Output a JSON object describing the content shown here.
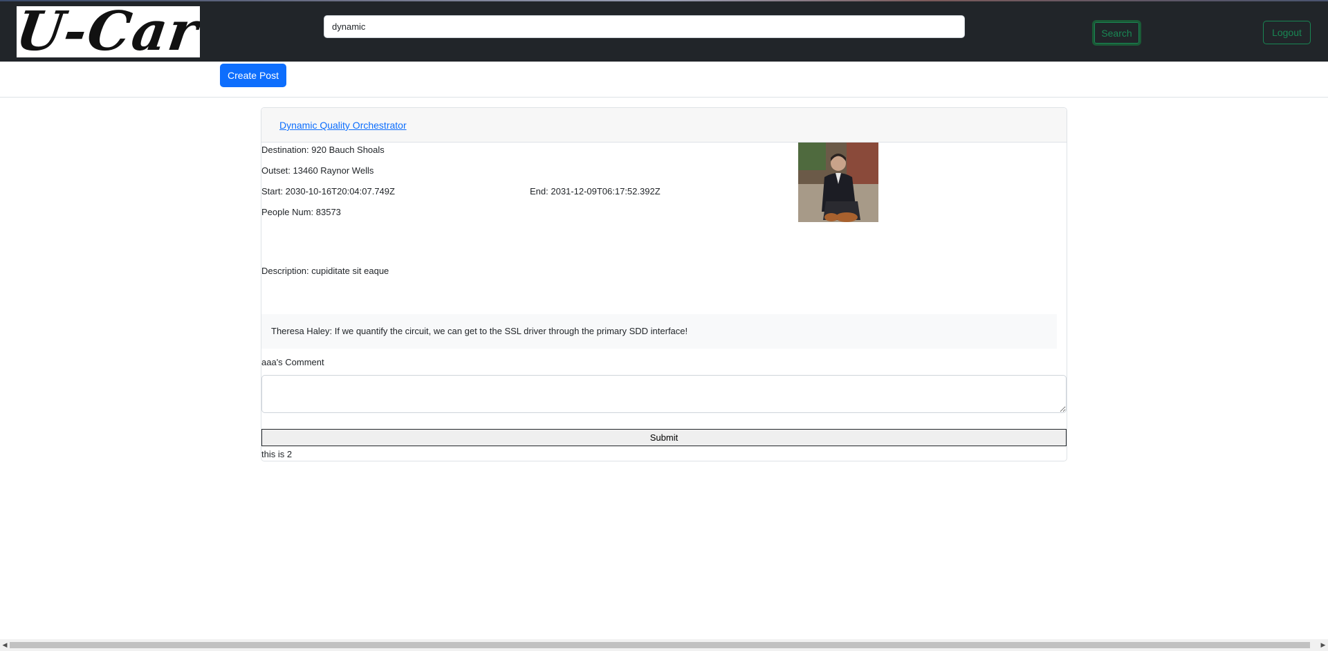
{
  "header": {
    "logo_text": "U-Car",
    "search": {
      "value": "dynamic",
      "button_label": "Search"
    },
    "logout_label": "Logout"
  },
  "toolbar": {
    "create_post_label": "Create Post"
  },
  "post": {
    "title": "Dynamic Quality Orchestrator",
    "destination": "Destination: 920 Bauch Shoals",
    "outset": "Outset: 13460 Raynor Wells",
    "start": "Start: 2030-10-16T20:04:07.749Z",
    "end": "End: 2031-12-09T06:17:52.392Z",
    "people_num": "People Num: 83573",
    "description": "Description: cupiditate sit eaque",
    "comments": [
      {
        "text": "Theresa Haley: If we quantify the circuit, we can get to the SSL driver through the primary SDD interface!"
      }
    ],
    "comment_form": {
      "label": "aaa's Comment",
      "value": "",
      "submit_label": "Submit"
    },
    "footer_note": "this is 2"
  },
  "colors": {
    "navbar_bg": "#212529",
    "primary": "#0d6efd",
    "success": "#198754"
  },
  "icons": {
    "scroll_left": "scroll-left-arrow-icon",
    "scroll_right": "scroll-right-arrow-icon"
  }
}
